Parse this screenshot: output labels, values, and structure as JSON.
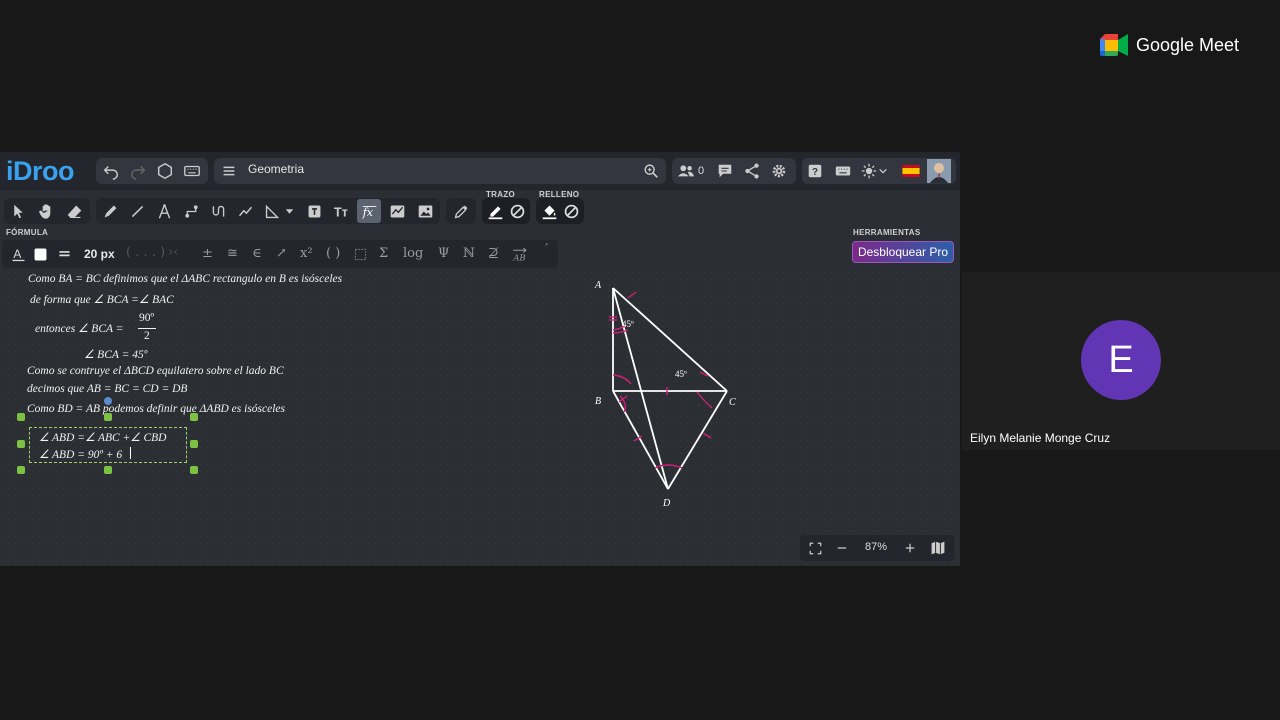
{
  "meet": {
    "brand": "Google Meet",
    "participant_initial": "E",
    "participant_name": "Eilyn Melanie Monge Cruz"
  },
  "idroo": {
    "logo": "iDroo",
    "doc_title": "Geometria",
    "users_count": "0",
    "labels": {
      "trazo": "TRAZO",
      "relleno": "RELLENO",
      "formula": "FÓRMULA",
      "herramientas": "HERRAMIENTAS"
    },
    "font_size": "20 px",
    "formula_items": [
      "±",
      "≅",
      "∈",
      "↗",
      "x²",
      "( )",
      "Σ",
      "log",
      "Ψ",
      "ℕ",
      "⊉"
    ],
    "pro_button": "Desbloquear Pro",
    "zoom": "87%",
    "colors": {
      "accent": "#3aa1ee",
      "stroke": "#ffffff",
      "selection": "#7dc142"
    }
  },
  "board": {
    "line1": "Como BA = BC definimos que el ΔABC rectangulo en B es isósceles",
    "line2": "de forma que  ∠ BCA =∠ BAC",
    "entonces": "entonces  ∠ BCA =",
    "frac_num": "90º",
    "frac_den": "2",
    "line4": "∠ BCA = 45º",
    "line5": "Como se contruye el ΔBCD equilatero sobre el lado BC",
    "line6": "decimos que AB = BC = CD = DB",
    "line7": "Como BD = AB podemos definir que ΔABD es isósceles",
    "sel1": "∠ ABD =∠ ABC +∠ CBD",
    "sel2": "∠ ABD = 90º + 6",
    "fig": {
      "A": "A",
      "B": "B",
      "C": "C",
      "D": "D",
      "angle1": "45º",
      "angle2": "45º"
    }
  }
}
